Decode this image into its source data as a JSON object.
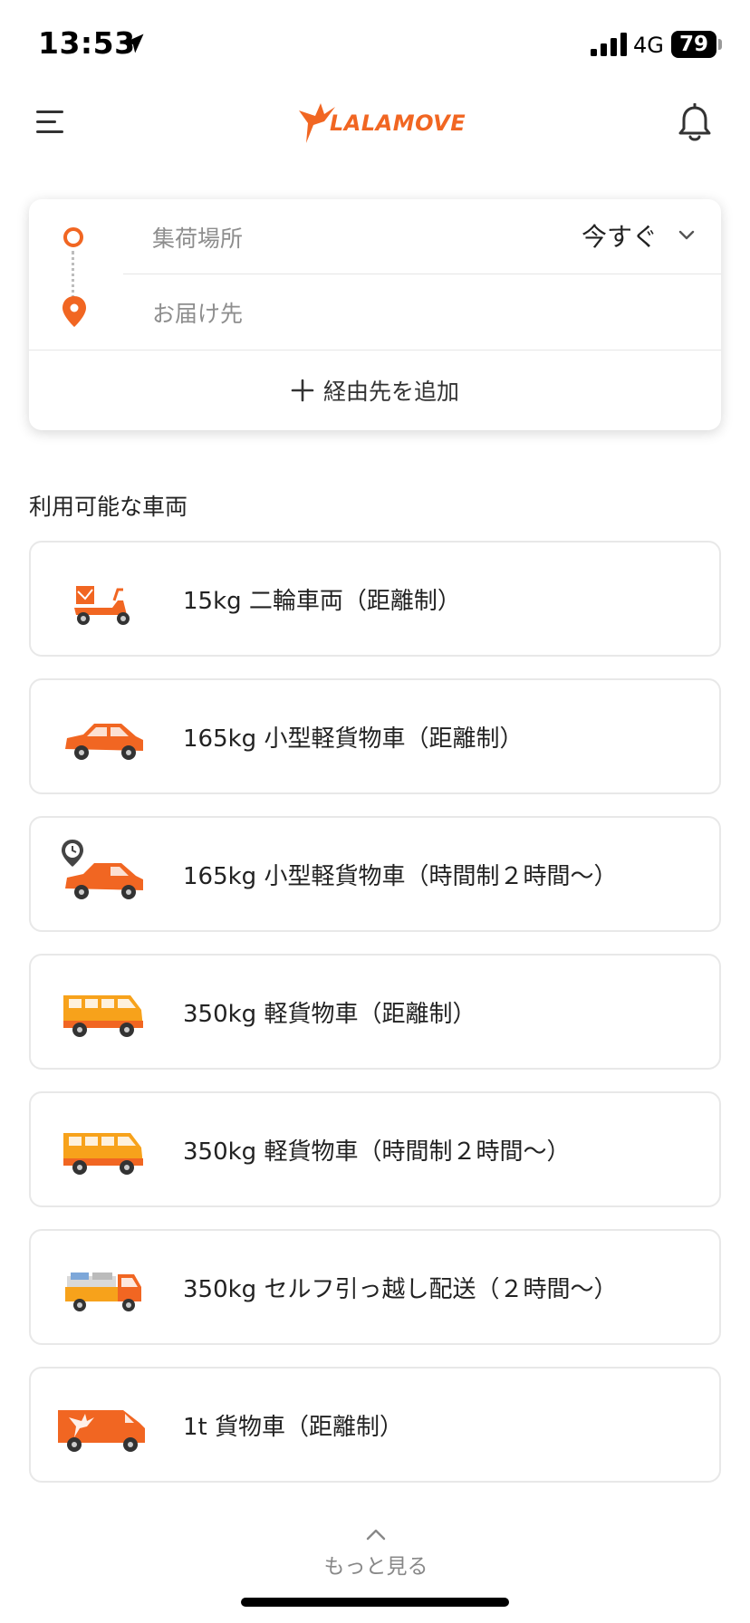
{
  "status_bar": {
    "time": "13:53",
    "network": "4G",
    "battery": "79"
  },
  "header": {
    "logo_text": "LALAMOVE",
    "menu_icon": "hamburger-menu-icon",
    "notification_icon": "bell-icon"
  },
  "route": {
    "pickup_placeholder": "集荷場所",
    "destination_placeholder": "お届け先",
    "time_value": "今すぐ",
    "add_stop_label": "経由先を追加",
    "accent_color": "#f16622"
  },
  "vehicles": {
    "section_title": "利用可能な車両",
    "items": [
      {
        "label": "15kg 二輪車両（距離制）",
        "icon": "scooter-icon"
      },
      {
        "label": "165kg 小型軽貨物車（距離制）",
        "icon": "compact-car-icon"
      },
      {
        "label": "165kg 小型軽貨物車（時間制２時間〜）",
        "icon": "compact-car-clock-icon"
      },
      {
        "label": "350kg 軽貨物車（距離制）",
        "icon": "minivan-icon"
      },
      {
        "label": "350kg 軽貨物車（時間制２時間〜）",
        "icon": "minivan-icon"
      },
      {
        "label": "350kg セルフ引っ越し配送（２時間〜）",
        "icon": "light-truck-icon"
      },
      {
        "label": "1t 貨物車（距離制）",
        "icon": "large-van-icon"
      }
    ]
  },
  "footer": {
    "more_label": "もっと見る"
  }
}
